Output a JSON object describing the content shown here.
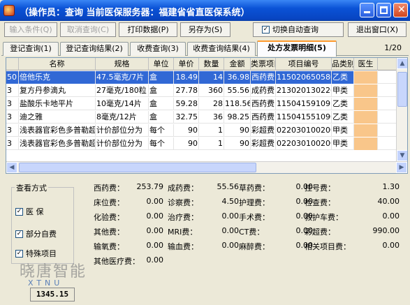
{
  "window": {
    "title": "（操作员：查询 当前医保服务器：福建省省直医保系统）"
  },
  "toolbar": {
    "input_condition": "输入条件(Q)",
    "cancel_query": "取消查询(C)",
    "print_data": "打印数据(P)",
    "save_as": "另存为(S)",
    "auto_query_label": "切换自动查询",
    "auto_query_checked": "✓",
    "exit_window": "退出窗口(X)"
  },
  "tabs": [
    {
      "label": "登记查询(1)"
    },
    {
      "label": "登记查询结果(2)"
    },
    {
      "label": "收费查询(3)"
    },
    {
      "label": "收费查询结果(4)"
    },
    {
      "label": "处方发票明细(5)"
    }
  ],
  "page_indicator": "1/20",
  "grid": {
    "headers": [
      "名称",
      "规格",
      "单位",
      "单价",
      "数量",
      "金额",
      "类票项目",
      "项目编号",
      "品类别",
      "医生"
    ],
    "rows": [
      {
        "idx": "50",
        "name": "倍他乐克",
        "spec": "47.5毫克/7片",
        "unit": "盒",
        "price": "18.49",
        "qty": "14",
        "amount": "36.98",
        "fee_type": "西药费",
        "code": "11502065058000",
        "category": "乙类"
      },
      {
        "idx": "3",
        "name": "复方丹参滴丸",
        "spec": "27毫克/180粒",
        "unit": "盒",
        "price": "27.78",
        "qty": "360",
        "amount": "55.56",
        "fee_type": "成药费",
        "code": "21302013022624",
        "category": "甲类"
      },
      {
        "idx": "3",
        "name": "盐酸乐卡地平片",
        "spec": "10毫克/14片",
        "unit": "盒",
        "price": "59.28",
        "qty": "28",
        "amount": "118.56",
        "fee_type": "西药费",
        "code": "11504159109163",
        "category": "乙类"
      },
      {
        "idx": "3",
        "name": "迪之雅",
        "spec": "8毫克/12片",
        "unit": "盒",
        "price": "32.75",
        "qty": "36",
        "amount": "98.25",
        "fee_type": "西药费",
        "code": "11504155109064",
        "category": "乙类"
      },
      {
        "idx": "3",
        "name": "浅表器官彩色多普勒超",
        "spec": "计价部位分为",
        "unit": "每个",
        "price": "90",
        "qty": "1",
        "amount": "90",
        "fee_type": "彩超费",
        "code": "022030100200",
        "category": "甲类"
      },
      {
        "idx": "3",
        "name": "浅表器官彩色多普勒超",
        "spec": "计价部位分为",
        "unit": "每个",
        "price": "90",
        "qty": "1",
        "amount": "90",
        "fee_type": "彩超费",
        "code": "022030100200",
        "category": "甲类"
      }
    ]
  },
  "view_mode": {
    "title": "查看方式",
    "items": [
      {
        "label": "医  保",
        "checked": "✓"
      },
      {
        "label": "部分自费",
        "checked": "✓"
      },
      {
        "label": "特殊项目",
        "checked": "✓"
      }
    ]
  },
  "fees": {
    "col1": [
      {
        "label": "西药费：",
        "value": "253.79"
      },
      {
        "label": "床位费：",
        "value": "0.00"
      },
      {
        "label": "化验费：",
        "value": "0.00"
      },
      {
        "label": "其他费：",
        "value": "0.00"
      },
      {
        "label": "输氧费：",
        "value": "0.00"
      },
      {
        "label": "其他医疗费：",
        "value": "0.00"
      }
    ],
    "col2": [
      {
        "label": "成药费：",
        "value": "55.56"
      },
      {
        "label": "诊察费：",
        "value": "4.50"
      },
      {
        "label": "治疗费：",
        "value": "0.00"
      },
      {
        "label": "MRI费：",
        "value": "0.00"
      },
      {
        "label": "输血费：",
        "value": "0.00"
      }
    ],
    "col3": [
      {
        "label": "草药费：",
        "value": "0.00"
      },
      {
        "label": "护理费：",
        "value": "0.00"
      },
      {
        "label": "手术费：",
        "value": "0.00"
      },
      {
        "label": "CT费：",
        "value": "0.00"
      },
      {
        "label": "麻醉费：",
        "value": "0.00"
      }
    ],
    "col4": [
      {
        "label": "挂号费：",
        "value": "1.30"
      },
      {
        "label": "检查费：",
        "value": "40.00"
      },
      {
        "label": "救护车费：",
        "value": "0.00"
      },
      {
        "label": "彩超费：",
        "value": "990.00"
      },
      {
        "label": "相关项目费：",
        "value": "0.00"
      }
    ]
  },
  "watermark": {
    "text": "晓唐智能",
    "sub": "XTNU"
  },
  "total": "1345.15",
  "colors": {
    "selected_row": "#3168d5",
    "doctor_cell": "#f9c68a",
    "title_bar": "#0a52d6"
  }
}
